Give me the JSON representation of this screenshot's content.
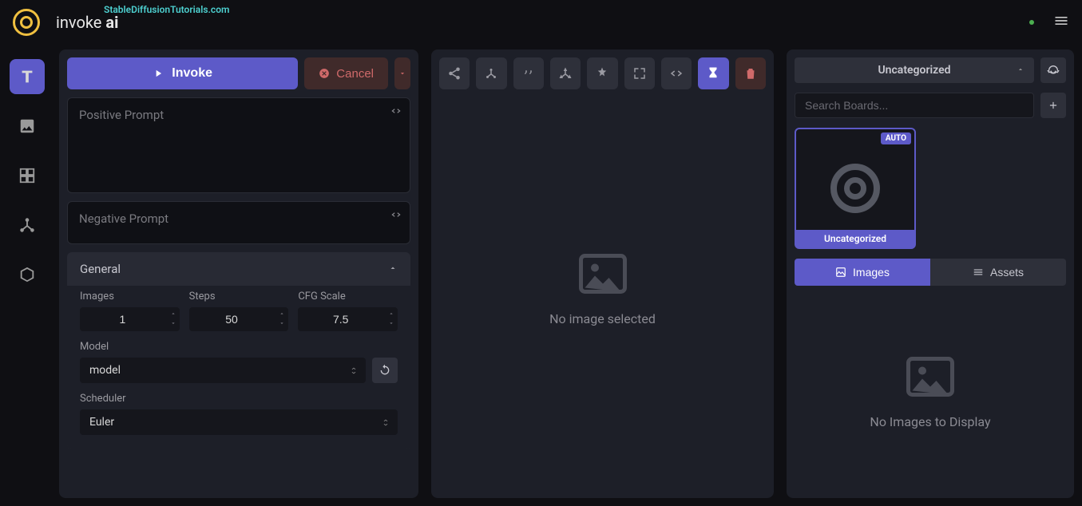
{
  "watermark": "StableDiffusionTutorials.com",
  "brand_light": "invoke ",
  "brand_bold": "ai",
  "actions": {
    "invoke": "Invoke",
    "cancel": "Cancel"
  },
  "prompts": {
    "positive": "Positive Prompt",
    "negative": "Negative Prompt"
  },
  "general": {
    "title": "General",
    "images_label": "Images",
    "images_value": "1",
    "steps_label": "Steps",
    "steps_value": "50",
    "cfg_label": "CFG Scale",
    "cfg_value": "7.5",
    "model_label": "Model",
    "model_value": "model",
    "scheduler_label": "Scheduler",
    "scheduler_value": "Euler"
  },
  "center": {
    "empty": "No image selected"
  },
  "right": {
    "board": "Uncategorized",
    "search_placeholder": "Search Boards...",
    "thumb_badge": "AUTO",
    "thumb_label": "Uncategorized",
    "tab_images": "Images",
    "tab_assets": "Assets",
    "empty": "No Images to Display"
  }
}
